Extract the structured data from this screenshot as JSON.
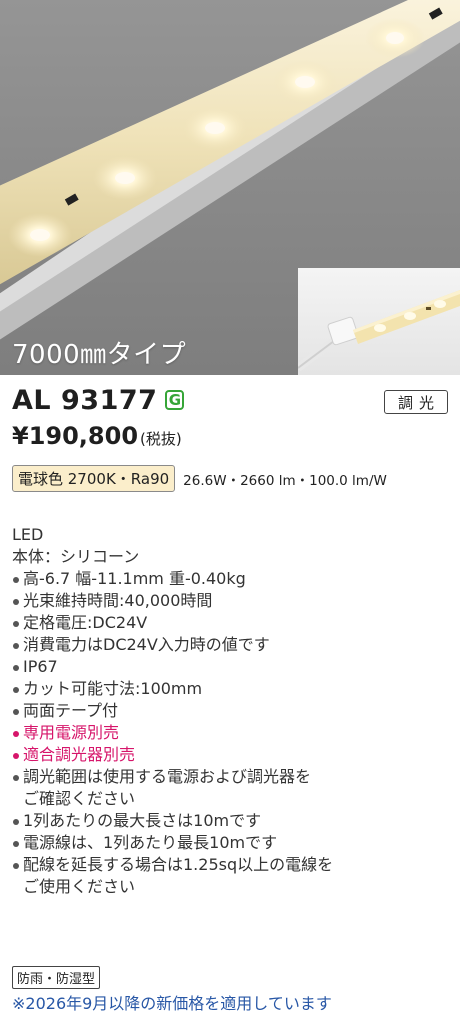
{
  "product": {
    "variant_label": "7000㎜タイプ",
    "model": "AL 93177",
    "grade_badge": "G",
    "feature_badge": "調光",
    "price": "¥190,800",
    "tax_note": "(税抜)",
    "color_temp_badge": "電球色 2700K・Ra90",
    "performance": "26.6W・2660 lm・100.0 lm/W"
  },
  "specs": {
    "category": "LED",
    "material": "本体：シリコーン",
    "bullets": [
      {
        "text": "高-6.7 幅-11.1mm 重-0.40kg",
        "highlight": false
      },
      {
        "text": "光束維持時間:40,000時間",
        "highlight": false
      },
      {
        "text": "定格電圧:DC24V",
        "highlight": false
      },
      {
        "text": "消費電力はDC24V入力時の値です",
        "highlight": false
      },
      {
        "text": "IP67",
        "highlight": false
      },
      {
        "text": "カット可能寸法:100mm",
        "highlight": false
      },
      {
        "text": "両面テープ付",
        "highlight": false
      },
      {
        "text": "専用電源別売",
        "highlight": true
      },
      {
        "text": "適合調光器別売",
        "highlight": true
      },
      {
        "text": "調光範囲は使用する電源および調光器を",
        "highlight": false
      },
      {
        "text": "1列あたりの最大長さは10mです",
        "highlight": false
      },
      {
        "text": "電源線は、1列あたり最長10mです",
        "highlight": false
      },
      {
        "text": "配線を延長する場合は1.25sq以上の電線を",
        "highlight": false
      }
    ],
    "continuation_1": "ご確認ください",
    "continuation_2": "ご使用ください"
  },
  "footer": {
    "rating_badge": "防雨・防湿型",
    "price_notice": "※2026年9月以降の新価格を適用しています"
  },
  "colors": {
    "accent_pink": "#d6156a",
    "notice_blue": "#2857a6",
    "badge_green": "#36a537",
    "color_badge_bg": "#fbeecb"
  }
}
